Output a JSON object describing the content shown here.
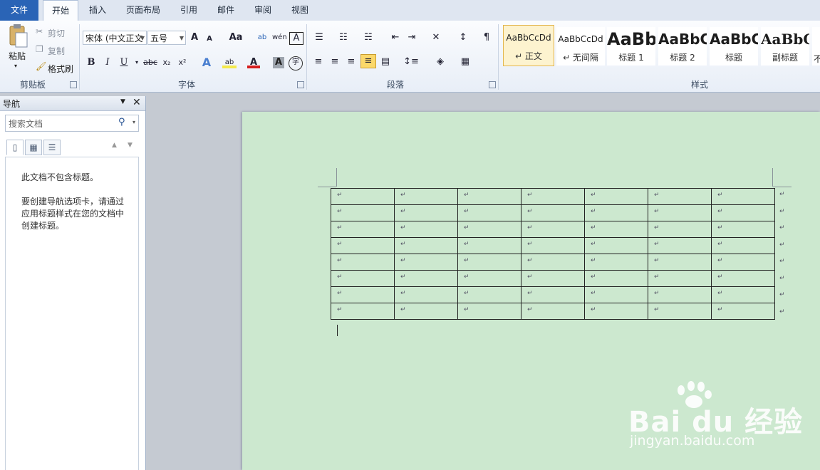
{
  "tabs": [
    {
      "label": "文件"
    },
    {
      "label": "开始"
    },
    {
      "label": "插入"
    },
    {
      "label": "页面布局"
    },
    {
      "label": "引用"
    },
    {
      "label": "邮件"
    },
    {
      "label": "审阅"
    },
    {
      "label": "视图"
    }
  ],
  "clipboard": {
    "paste": "粘贴",
    "cut": "剪切",
    "copy": "复制",
    "format_painter": "格式刷",
    "group_label": "剪贴板"
  },
  "font": {
    "font_name": "宋体 (中文正文",
    "font_size": "五号",
    "group_label": "字体",
    "bold": "B",
    "italic": "I",
    "underline": "U",
    "strike": "abc",
    "subscript": "x₂",
    "superscript": "x²",
    "grow": "A",
    "shrink": "A",
    "change_case": "Aa"
  },
  "paragraph": {
    "group_label": "段落"
  },
  "styles": {
    "group_label": "样式",
    "items": [
      {
        "sample": "AaBbCcDd",
        "name": "↵ 正文"
      },
      {
        "sample": "AaBbCcDd",
        "name": "↵ 无间隔"
      },
      {
        "sample": "AaBb",
        "name": "标题 1"
      },
      {
        "sample": "AaBbC",
        "name": "标题 2"
      },
      {
        "sample": "AaBbC",
        "name": "标题"
      },
      {
        "sample": "AaBbC",
        "name": "副标题"
      }
    ],
    "partial_next": "不"
  },
  "nav": {
    "title": "导航",
    "search_placeholder": "搜索文档",
    "msg1": "此文档不包含标题。",
    "msg2_line1": "要创建导航选项卡，请通过",
    "msg2_line2": "应用标题样式在您的文档中",
    "msg2_line3": "创建标题。"
  },
  "document": {
    "table_rows": 8,
    "table_cols": 7,
    "cell_mark": "↵",
    "background": "#cce8cf"
  },
  "watermark": {
    "brand": "Bai du 经验",
    "url": "jingyan.baidu.com"
  },
  "colors": {
    "file_tab": "#2a64b6",
    "selected_style": "#fdf3cf"
  }
}
